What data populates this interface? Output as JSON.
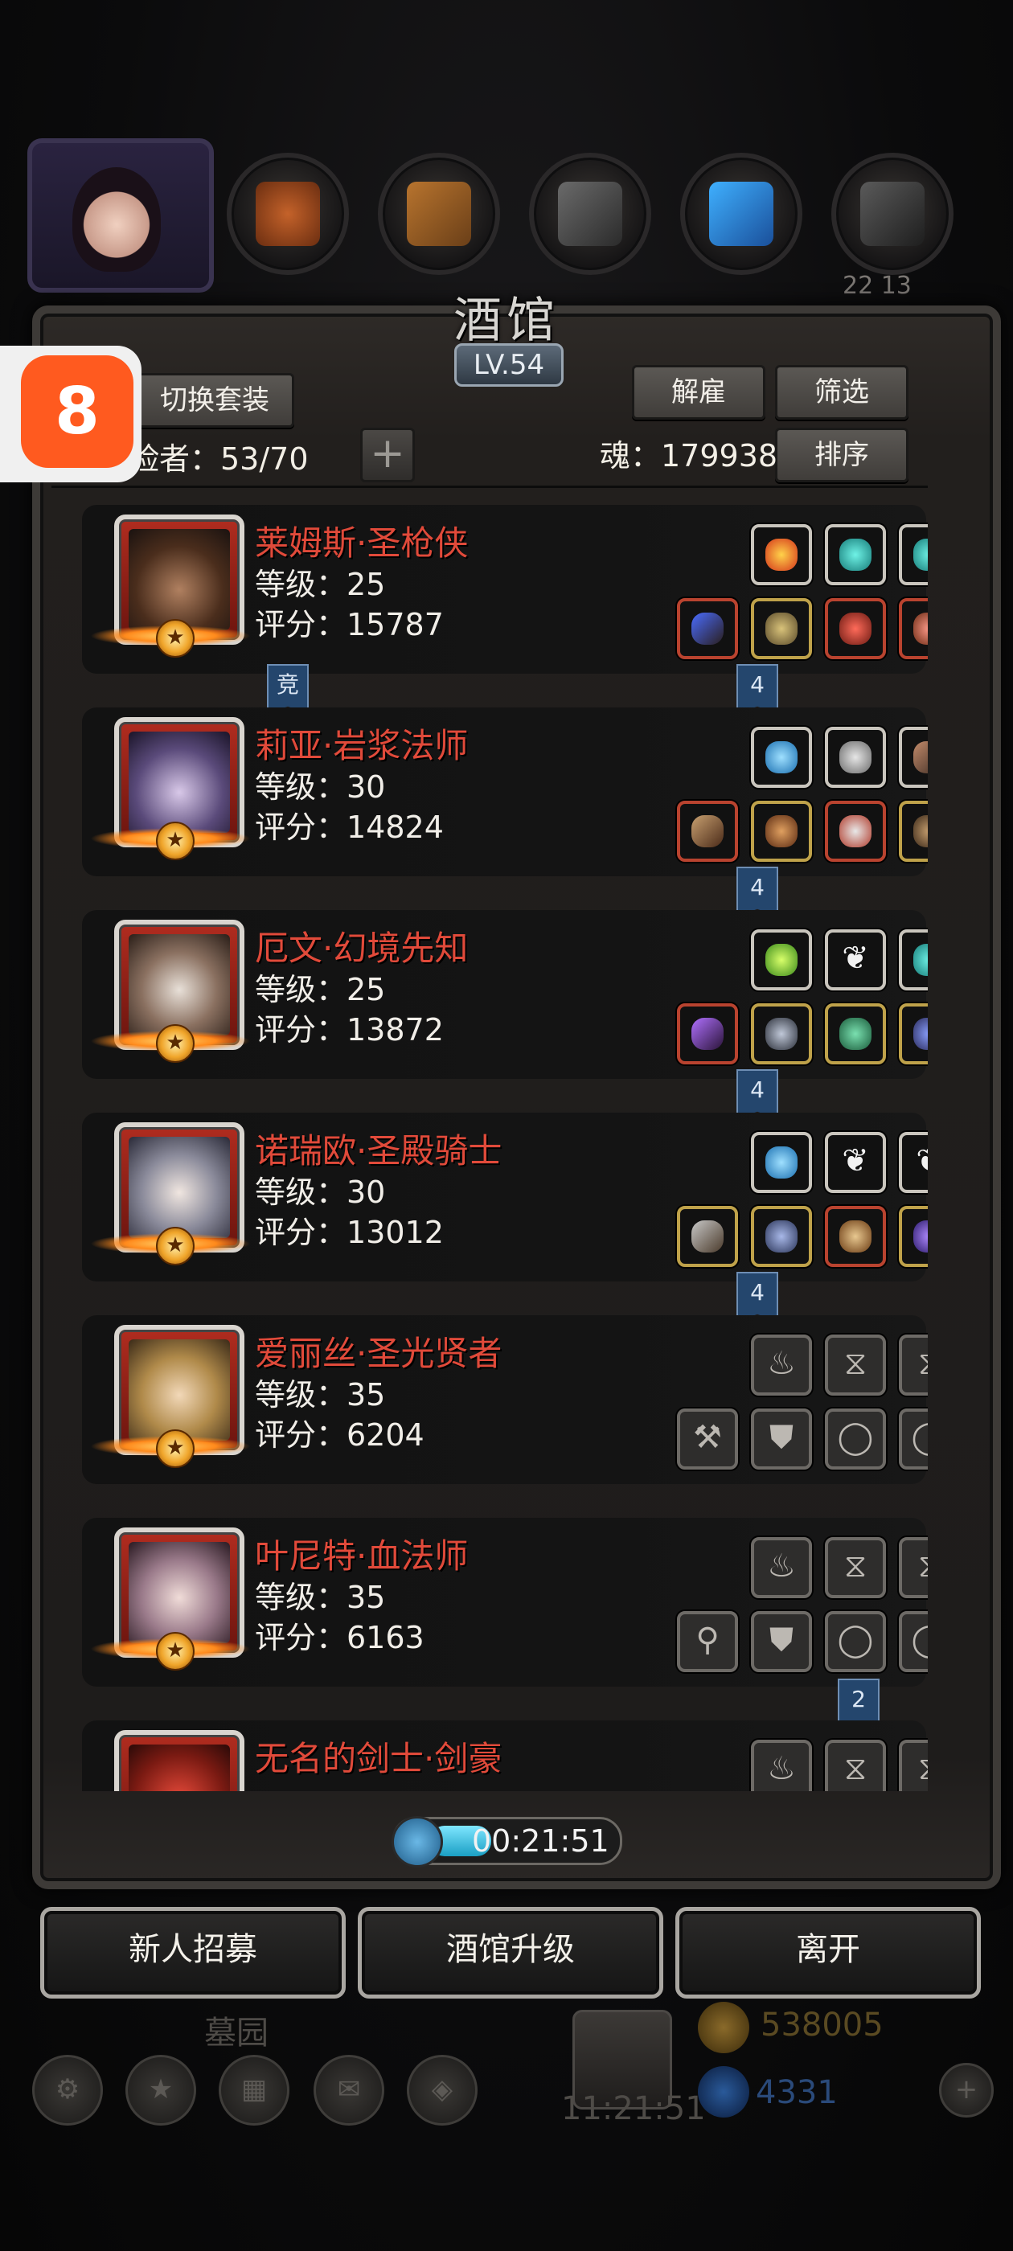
{
  "top_bar": {
    "tabs": [
      "avatar",
      "wood-resource",
      "plank-resource",
      "iron-resource",
      "crystal-resource",
      "steel-resource"
    ],
    "right_number": "22 13"
  },
  "panel": {
    "title": "酒馆",
    "level_badge": "LV.54",
    "switch_outfit_label": "切换套装",
    "dismiss_label": "解雇",
    "filter_label": "筛选",
    "sort_label": "排序",
    "adventurers_label": "险者：53/70",
    "soul_label": "魂：179938",
    "add_label": "+"
  },
  "heroes": [
    {
      "name": "莱姆斯·圣枪侠",
      "level": "等级：25",
      "score": "评分：15787",
      "bookmark_left": "竞",
      "bookmark_right": "4"
    },
    {
      "name": "莉亚·岩浆法师",
      "level": "等级：30",
      "score": "评分：14824",
      "bookmark_right": "4"
    },
    {
      "name": "厄文·幻境先知",
      "level": "等级：25",
      "score": "评分：13872",
      "bookmark_right": "4"
    },
    {
      "name": "诺瑞欧·圣殿骑士",
      "level": "等级：30",
      "score": "评分：13012",
      "bookmark_right": "4"
    },
    {
      "name": "爱丽丝·圣光贤者",
      "level": "等级：35",
      "score": "评分：6204"
    },
    {
      "name": "叶尼特·血法师",
      "level": "等级：35",
      "score": "评分：6163",
      "bookmark_right": "2"
    },
    {
      "name": "无名的剑士·剑豪",
      "level": "",
      "score": ""
    }
  ],
  "timer": {
    "text": "00:21:51",
    "fill_fraction": 0.33
  },
  "bottom_buttons": {
    "recruit": "新人招募",
    "upgrade": "酒馆升级",
    "leave": "离开"
  },
  "hud": {
    "graveyard": "墓园",
    "gift_timer": "11:21:51",
    "gold": "538005",
    "gems": "4331"
  },
  "colors": {
    "hero_name": "#e14a3a",
    "panel_bg": "#1e1c1b",
    "bookmark": "#24466d",
    "app_badge": "#ff5a1f"
  }
}
